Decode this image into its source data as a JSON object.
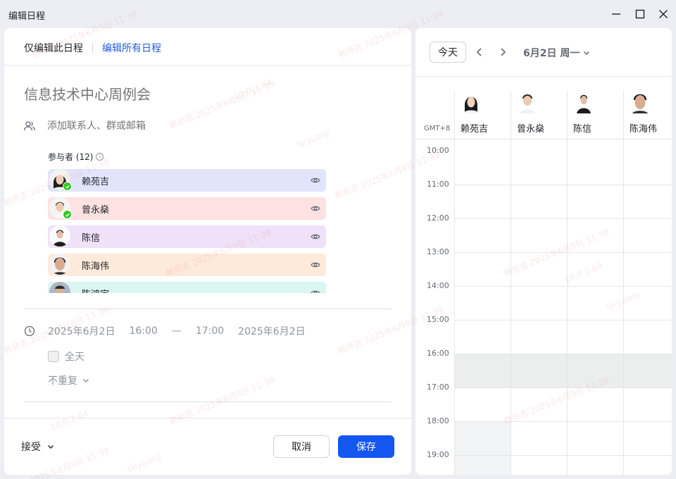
{
  "window": {
    "title": "编辑日程",
    "minimize_icon": "minimize-icon",
    "maximize_icon": "maximize-icon",
    "close_icon": "close-icon"
  },
  "scope_tabs": {
    "this_only": "仅编辑此日程",
    "all": "编辑所有日程"
  },
  "event": {
    "title_placeholder": "信息技术中心周例会",
    "contact_placeholder": "添加联系人、群或邮箱"
  },
  "attendees": {
    "label": "参与者 (12)",
    "info_icon": "info-icon",
    "list": [
      {
        "name": "赖苑吉",
        "color": "#e1e4fb",
        "accepted": true
      },
      {
        "name": "曾永燊",
        "color": "#fde2e1",
        "accepted": true
      },
      {
        "name": "陈信",
        "color": "#efe1f8",
        "accepted": false
      },
      {
        "name": "陈海伟",
        "color": "#feeadb",
        "accepted": false
      },
      {
        "name": "陈鸿宇",
        "color": "#d9f6f2",
        "accepted": false
      }
    ]
  },
  "time": {
    "start_date": "2025年6月2日",
    "start_time": "16:00",
    "dash": "—",
    "end_time": "17:00",
    "end_date": "2025年6月2日",
    "all_day_label": "全天",
    "all_day_checked": false,
    "repeat": "不重复"
  },
  "footer": {
    "rsvp": "接受",
    "cancel": "取消",
    "save": "保存",
    "save_color": "#1456f0"
  },
  "calendar": {
    "today_btn": "今天",
    "date_label": "6月2日 周一",
    "timezone": "GMT+8",
    "people": [
      "赖苑吉",
      "曾永燊",
      "陈信",
      "陈海伟"
    ],
    "hours": [
      "10:00",
      "11:00",
      "12:00",
      "13:00",
      "14:00",
      "15:00",
      "16:00",
      "17:00",
      "18:00",
      "19:00"
    ],
    "busy_slot": "16:00–17:00"
  },
  "watermark": {
    "lines": [
      "赖苑吉 2025年6月9日 11:39",
      "10.0.2.64",
      "laiyuanji"
    ]
  }
}
